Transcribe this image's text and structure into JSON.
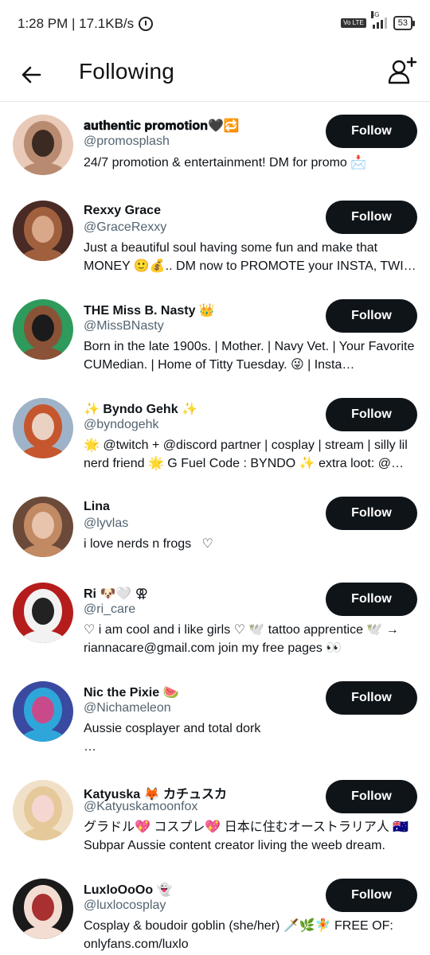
{
  "status_bar": {
    "time_speed": "1:28 PM | 17.1KB/s",
    "volte": "Vo LTE",
    "network": "4G",
    "battery": "53"
  },
  "header": {
    "title": "Following"
  },
  "follow_label": "Follow",
  "accounts": [
    {
      "name": "𝐚𝐮𝐭𝐡𝐞𝐧𝐭𝐢𝐜 𝐩𝐫𝐨𝐦𝐨𝐭𝐢𝐨𝐧🖤🔁",
      "handle": "@promosplash",
      "bio": "24/7 promotion & entertainment! DM for promo 📩",
      "avatar_colors": [
        "#e9c9b8",
        "#b88a70",
        "#3a2a22"
      ]
    },
    {
      "name": "Rexxy Grace",
      "handle": "@GraceRexxy",
      "bio": "Just a beautiful soul having some fun and make that MONEY 🙂💰.. DM now to PROMOTE your INSTA, TWI…",
      "avatar_colors": [
        "#4a2a24",
        "#a0603e",
        "#d9a88a"
      ]
    },
    {
      "name": "THE Miss B. Nasty 👑",
      "handle": "@MissBNasty",
      "bio": "Born in the late 1900s. | Mother. | Navy Vet. | Your Favorite CUMedian. | Home of Titty Tuesday. 😜 | Insta…",
      "avatar_colors": [
        "#2e9a5c",
        "#8a5236",
        "#1b1b1b"
      ]
    },
    {
      "name": "✨ Byndo Gehk ✨",
      "handle": "@byndogehk",
      "bio": "🌟 @twitch + @discord partner | cosplay | stream | silly lil nerd friend 🌟 G Fuel Code : BYNDO ✨ extra loot: @…",
      "avatar_colors": [
        "#9fb3c8",
        "#c6562e",
        "#e9d2c2"
      ]
    },
    {
      "name": "Lina",
      "handle": "@lyvlas",
      "bio": "i love nerds n frogs   ♡",
      "avatar_colors": [
        "#6b4a3a",
        "#c28a63",
        "#e8c4ad"
      ]
    },
    {
      "name": "Ri 🐶🤍 ⚢",
      "handle": "@ri_care",
      "bio": "♡ i am cool and i like girls ♡ 🕊️ tattoo apprentice 🕊️ → riannacare@gmail.com join my free pages 👀",
      "avatar_colors": [
        "#b51c1c",
        "#f2f2f2",
        "#222222"
      ]
    },
    {
      "name": "Nic the Pixie 🍉",
      "handle": "@Nichameleon",
      "bio": "Aussie cosplayer and total dork\n…",
      "avatar_colors": [
        "#3a4aa0",
        "#2fa6d9",
        "#c94a8a"
      ]
    },
    {
      "name": "Katyuska 🦊 カチュスカ",
      "handle": "@Katyuskamoonfox",
      "bio": "グラドル💖 コスプレ💖 日本に住むオーストラリア人 🇦🇺 Subpar Aussie content creator living the weeb dream.",
      "avatar_colors": [
        "#f1e0c8",
        "#e6c99a",
        "#f6d6d0"
      ]
    },
    {
      "name": "LuxloOoOo 👻",
      "handle": "@luxlocosplay",
      "bio": "Cosplay & boudoir goblin (she/her) 🗡️🌿🧚 FREE OF: onlyfans.com/luxlo",
      "avatar_colors": [
        "#1a1a1a",
        "#f3ddd2",
        "#a83030"
      ]
    }
  ]
}
